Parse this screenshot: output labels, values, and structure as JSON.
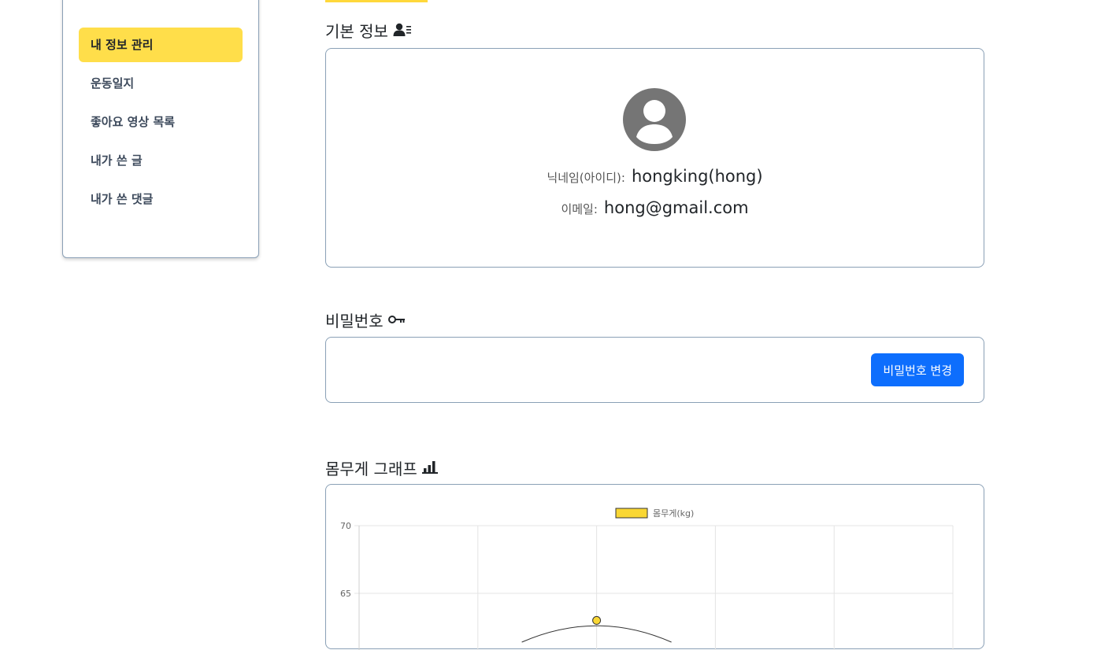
{
  "sidebar": {
    "items": [
      {
        "label": "내 정보 관리",
        "active": true
      },
      {
        "label": "운동일지",
        "active": false
      },
      {
        "label": "좋아요 영상 목록",
        "active": false
      },
      {
        "label": "내가 쓴 글",
        "active": false
      },
      {
        "label": "내가 쓴 댓글",
        "active": false
      }
    ]
  },
  "basic_info": {
    "title": "기본 정보",
    "icon": "user-list-icon",
    "nickname_label": "닉네임(아이디):",
    "nickname_value": "hongking(hong)",
    "email_label": "이메일:",
    "email_value": "hong@gmail.com"
  },
  "password": {
    "title": "비밀번호",
    "icon": "key-icon",
    "change_button": "비밀번호 변경"
  },
  "weight_graph": {
    "title": "몸무게 그래프",
    "icon": "bar-chart-icon"
  },
  "colors": {
    "accent_yellow": "#ffde4a",
    "primary_blue": "#0d6efd",
    "card_border": "#8aa0b6",
    "series_fill": "#f9d734"
  },
  "chart_data": {
    "type": "line",
    "legend": [
      "몸무게(kg)"
    ],
    "legend_position": "top",
    "grid": true,
    "ylim_visible": [
      61.5,
      70
    ],
    "y_ticks": [
      70,
      65
    ],
    "series": [
      {
        "name": "몸무게(kg)",
        "x_index": [
          2
        ],
        "values": [
          63
        ]
      }
    ]
  }
}
